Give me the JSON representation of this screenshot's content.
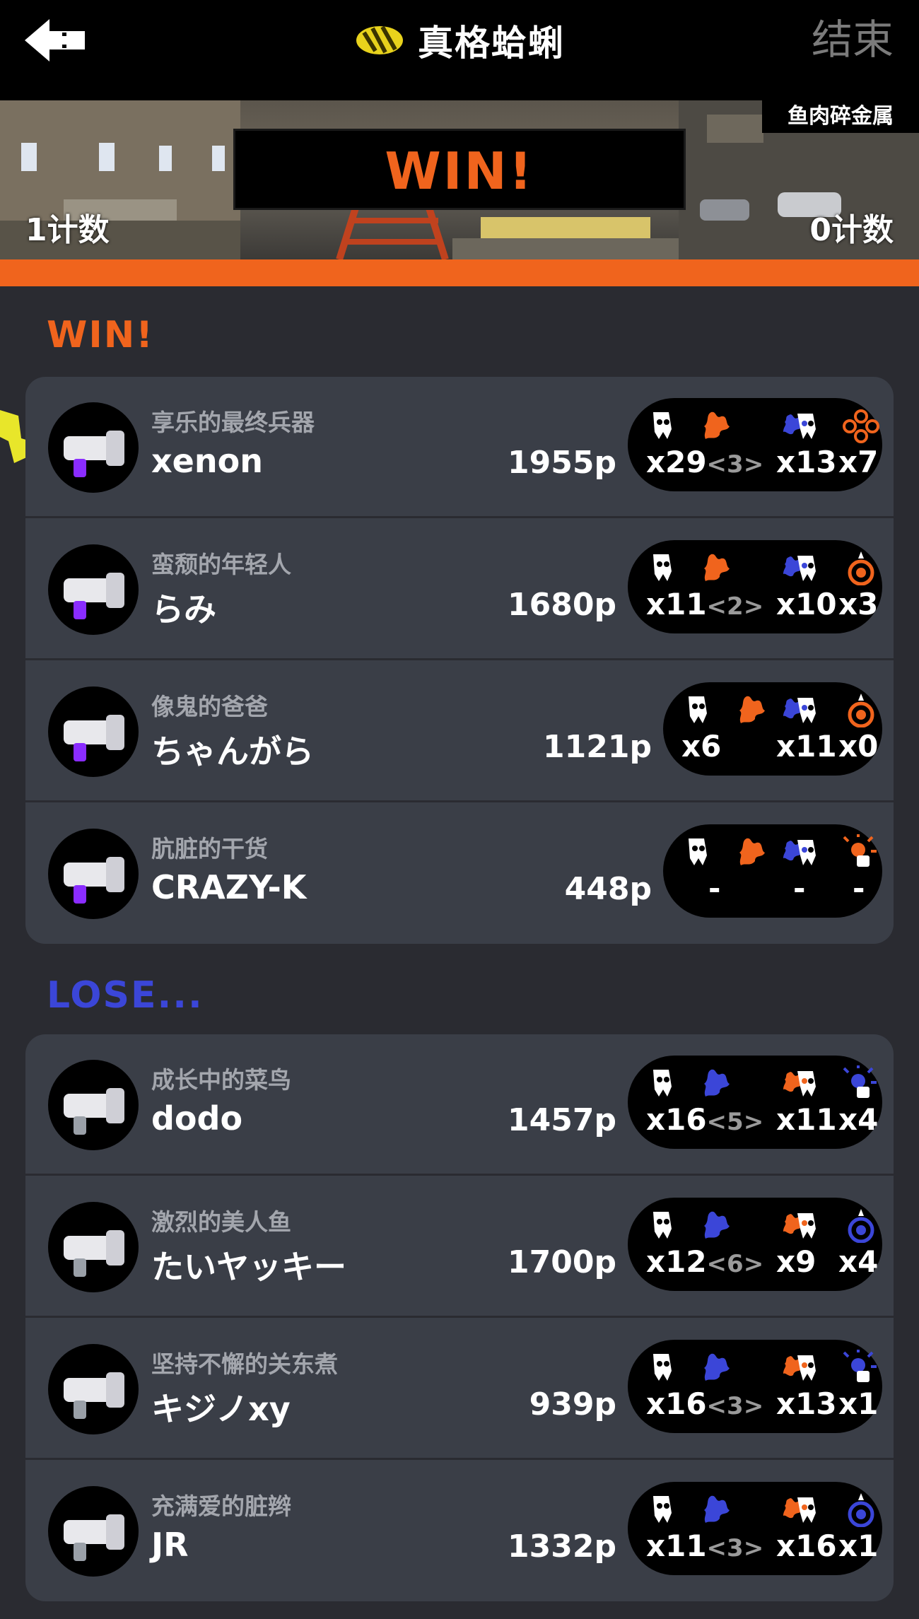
{
  "header": {
    "back_icon": "arrow-left-icon",
    "mode_icon": "rainmaker-icon",
    "title": "真格蛤蜊",
    "end_label": "结束"
  },
  "banner": {
    "stage": "鱼肉碎金属",
    "result": "WIN!",
    "left_count": "1计数",
    "right_count": "0计数",
    "accent": "#f0641d"
  },
  "win_team": {
    "label": "WIN!",
    "color": "#f0641d",
    "players": [
      {
        "title": "享乐的最终兵器",
        "name": "xenon",
        "points": "1955p",
        "kills": "x29",
        "assists": "<3>",
        "deaths": "x13",
        "specials": "x7",
        "weapon_icon": "roller-gun-icon",
        "special_icon": "splat-bombs-icon"
      },
      {
        "title": "蛮颓的年轻人",
        "name": "らみ",
        "points": "1680p",
        "kills": "x11",
        "assists": "<2>",
        "deaths": "x10",
        "specials": "x3",
        "weapon_icon": "splattershot-icon",
        "special_icon": "booyah-bomb-icon"
      },
      {
        "title": "像鬼的爸爸",
        "name": "ちゃんがら",
        "points": "1121p",
        "kills": "x6",
        "assists": "",
        "deaths": "x11",
        "specials": "x0",
        "weapon_icon": "roller-icon",
        "special_icon": "booyah-bomb-icon"
      },
      {
        "title": "肮脏的干货",
        "name": "CRAZY-K",
        "points": "448p",
        "kills": "-",
        "assists": "",
        "deaths": "-",
        "specials": "-",
        "weapon_icon": "dualies-icon",
        "special_icon": "sting-ray-icon"
      }
    ]
  },
  "lose_team": {
    "label": "LOSE...",
    "color": "#3b46d8",
    "players": [
      {
        "title": "成长中的菜鸟",
        "name": "dodo",
        "points": "1457p",
        "kills": "x16",
        "assists": "<5>",
        "deaths": "x11",
        "specials": "x4",
        "weapon_icon": "brush-icon",
        "special_icon": "sting-ray-icon"
      },
      {
        "title": "激烈的美人鱼",
        "name": "たいヤッキー",
        "points": "1700p",
        "kills": "x12",
        "assists": "<6>",
        "deaths": "x9",
        "specials": "x4",
        "weapon_icon": "splattershot-icon",
        "special_icon": "booyah-bomb-icon"
      },
      {
        "title": "坚持不懈的关东煮",
        "name": "キジノxy",
        "points": "939p",
        "kills": "x16",
        "assists": "<3>",
        "deaths": "x13",
        "specials": "x1",
        "weapon_icon": "sloshing-icon",
        "special_icon": "inkjet-icon"
      },
      {
        "title": "充满爱的脏辫",
        "name": "JR",
        "points": "1332p",
        "kills": "x11",
        "assists": "<3>",
        "deaths": "x16",
        "specials": "x1",
        "weapon_icon": "charger-icon",
        "special_icon": "baller-icon"
      }
    ]
  }
}
